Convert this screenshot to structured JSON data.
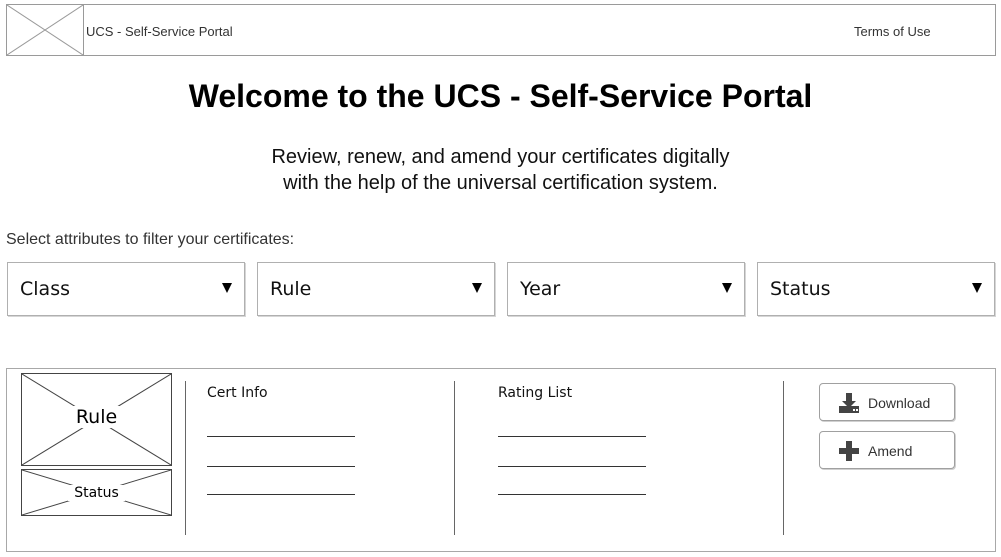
{
  "header": {
    "app_title": "UCS - Self-Service Portal",
    "terms_link": "Terms of Use",
    "logo_icon": "image-placeholder-icon"
  },
  "main": {
    "title": "Welcome to the UCS - Self-Service Portal",
    "subtitle_lines": [
      "Review, renew, and amend your certificates digitally",
      "with the help of the universal certification system."
    ],
    "filter_hint": "Select attributes to filter your certificates:"
  },
  "filters": [
    {
      "label": "Class"
    },
    {
      "label": "Rule"
    },
    {
      "label": "Year"
    },
    {
      "label": "Status"
    }
  ],
  "certificate_card": {
    "rule_image_label": "Rule",
    "status_image_label": "Status",
    "cert_info_title": "Cert Info",
    "rating_list_title": "Rating List",
    "actions": {
      "download_label": "Download",
      "download_icon": "download-icon",
      "amend_label": "Amend",
      "amend_icon": "plus-icon"
    }
  },
  "colors": {
    "border": "#9a9a9a",
    "text": "#000000",
    "muted_text": "#333333"
  }
}
